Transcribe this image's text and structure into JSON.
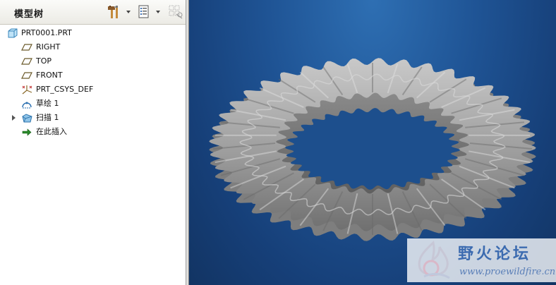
{
  "model_tree": {
    "title": "模型树",
    "toolbar": {
      "settings_icon": "tools-icon",
      "show_icon": "list-icon",
      "filter_icon": "filter-icon"
    },
    "items": [
      {
        "label": "PRT0001.PRT",
        "icon": "part-icon",
        "indent": 0
      },
      {
        "label": "RIGHT",
        "icon": "datum-plane-icon",
        "indent": 1
      },
      {
        "label": "TOP",
        "icon": "datum-plane-icon",
        "indent": 1
      },
      {
        "label": "FRONT",
        "icon": "datum-plane-icon",
        "indent": 1
      },
      {
        "label": "PRT_CSYS_DEF",
        "icon": "csys-icon",
        "indent": 1
      },
      {
        "label": "草绘 1",
        "icon": "sketch-icon",
        "indent": 1
      },
      {
        "label": "扫描 1",
        "icon": "sweep-icon",
        "indent": 1,
        "expandable": true
      },
      {
        "label": "在此插入",
        "icon": "insert-arrow-icon",
        "indent": 1
      }
    ]
  },
  "viewport": {
    "background_color": "#1f5495",
    "model_color": "#a8a8a8"
  },
  "watermark": {
    "name": "野火论坛",
    "url": "www.proewildfire.cn"
  }
}
